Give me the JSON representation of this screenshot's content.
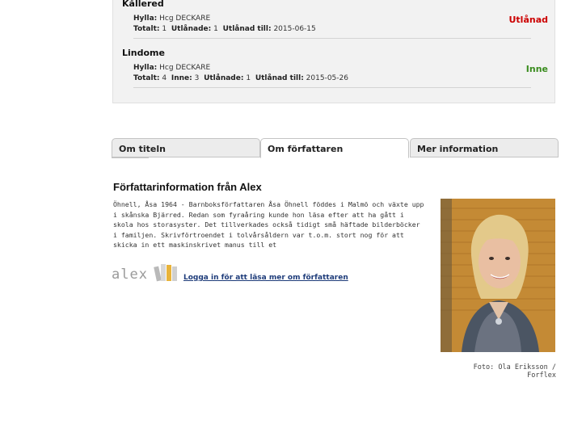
{
  "availability": {
    "branches": [
      {
        "name": "Kållered",
        "shelf_label": "Hylla:",
        "shelf_value": "Hcg DECKARE",
        "total_label": "Totalt:",
        "total_value": "1",
        "loaned_label": "Utlånade:",
        "loaned_value": "1",
        "loaned_until_label": "Utlånad till:",
        "loaned_until_value": "2015-06-15",
        "status": "Utlånad"
      },
      {
        "name": "Lindome",
        "shelf_label": "Hylla:",
        "shelf_value": "Hcg DECKARE",
        "total_label": "Totalt:",
        "total_value": "4",
        "in_label": "Inne:",
        "in_value": "3",
        "loaned_label": "Utlånade:",
        "loaned_value": "1",
        "loaned_until_label": "Utlånad till:",
        "loaned_until_value": "2015-05-26",
        "status": "Inne"
      }
    ],
    "status_colors": {
      "loaned": "#cc0000",
      "in": "#3a8c1e"
    }
  },
  "tabs": [
    {
      "label": "Om titeln",
      "active": false
    },
    {
      "label": "Om författaren",
      "active": true
    },
    {
      "label": "Mer information",
      "active": false
    }
  ],
  "author": {
    "section_title": "Författarinformation från Alex",
    "bio": "Öhnell, Åsa 1964 - Barnboksförfattaren Åsa Öhnell föddes i Malmö och växte upp i skånska Bjärred. Redan som fyraåring kunde hon läsa efter att ha gått i skola hos storasyster. Det tillverkades också tidigt små häftade bilderböcker i familjen. Skrivförtroendet i tolvårsåldern var t.o.m. stort nog för att skicka in ett maskinskrivet manus till et",
    "logo_text": "alex",
    "login_link": "Logga in för att läsa mer om författaren",
    "photo_credit": "Foto: Ola Eriksson / Forflex"
  }
}
